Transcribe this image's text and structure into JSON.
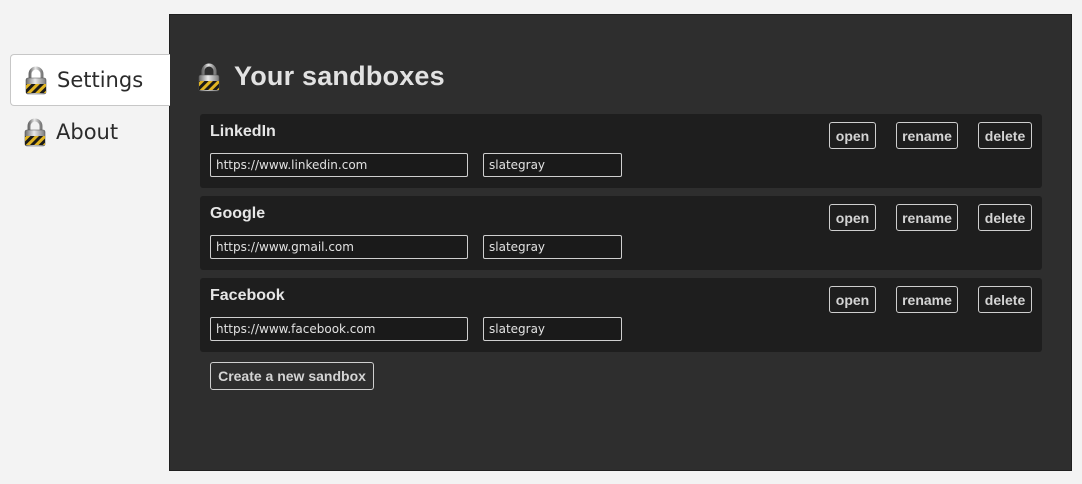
{
  "sidebar": {
    "items": [
      {
        "label": "Settings",
        "icon": "padlock-icon",
        "active": true
      },
      {
        "label": "About",
        "icon": "padlock-icon",
        "active": false
      }
    ]
  },
  "main": {
    "title": "Your sandboxes",
    "title_icon": "padlock-icon",
    "sandboxes": [
      {
        "name": "LinkedIn",
        "url": "https://www.linkedin.com",
        "color": "slategray",
        "buttons": {
          "open": "open",
          "rename": "rename",
          "delete": "delete"
        }
      },
      {
        "name": "Google",
        "url": "https://www.gmail.com",
        "color": "slategray",
        "buttons": {
          "open": "open",
          "rename": "rename",
          "delete": "delete"
        }
      },
      {
        "name": "Facebook",
        "url": "https://www.facebook.com",
        "color": "slategray",
        "buttons": {
          "open": "open",
          "rename": "rename",
          "delete": "delete"
        }
      }
    ],
    "create_label": "Create a new sandbox"
  },
  "colors": {
    "page_bg": "#f3f3f3",
    "panel_bg": "#2e2e2e",
    "card_bg": "#1e1e1e",
    "text_light": "#e2e2e2",
    "border_light": "#cfcfcf"
  }
}
